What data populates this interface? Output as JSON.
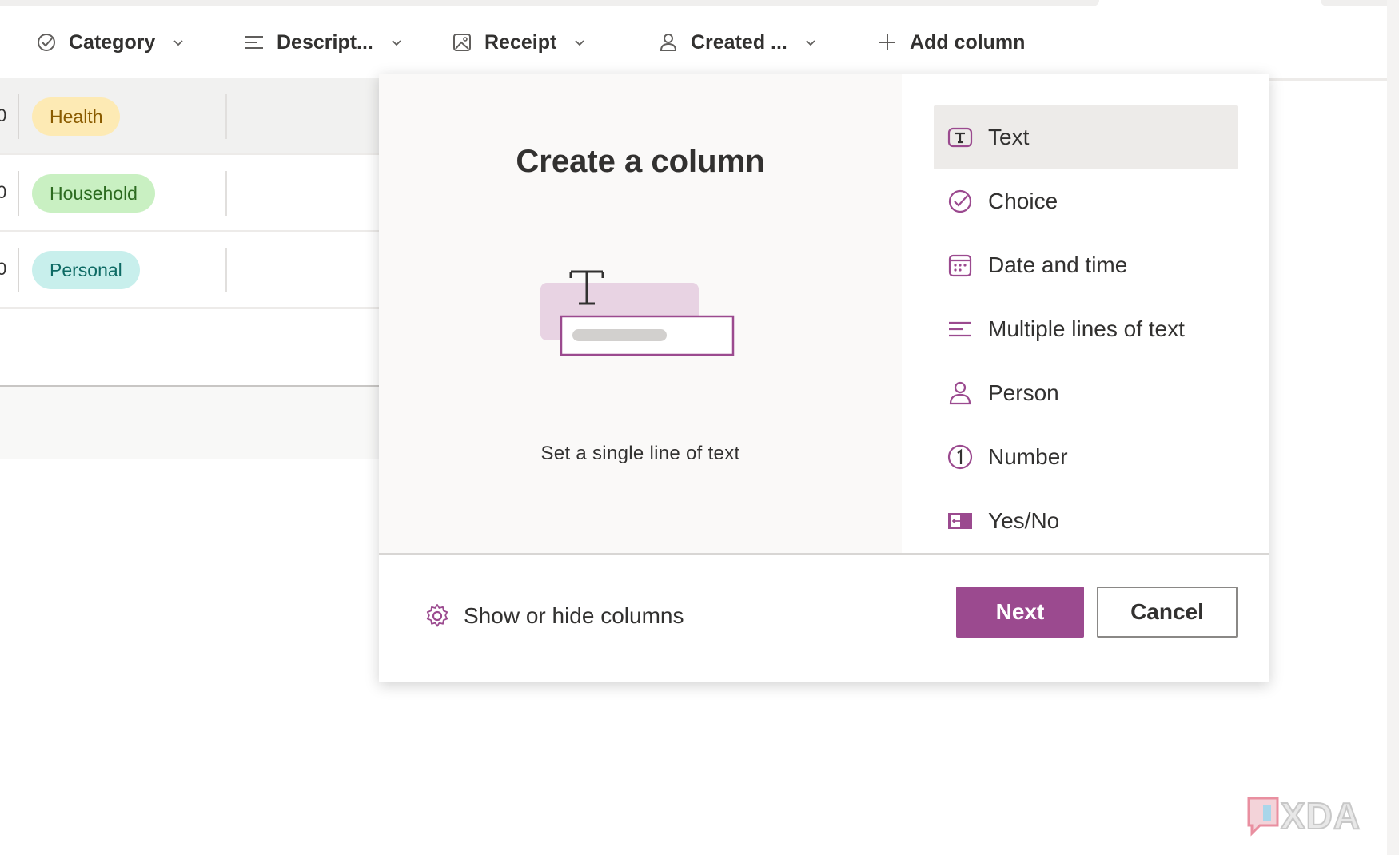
{
  "header": {
    "columns": [
      {
        "label": "Category",
        "icon": "choice-check-icon"
      },
      {
        "label": "Descript...",
        "icon": "lines-icon"
      },
      {
        "label": "Receipt",
        "icon": "image-icon"
      },
      {
        "label": "Created ...",
        "icon": "person-icon"
      }
    ],
    "add_column": "Add column"
  },
  "rows": [
    {
      "trunc": "0",
      "category": "Health",
      "pill_bg": "#fdeab4",
      "pill_fg": "#8a5b00"
    },
    {
      "trunc": "0",
      "category": "Household",
      "pill_bg": "#c9f0c2",
      "pill_fg": "#2c6b1f"
    },
    {
      "trunc": "0",
      "category": "Personal",
      "pill_bg": "#c8efec",
      "pill_fg": "#0e6a64"
    }
  ],
  "modal": {
    "title": "Create a column",
    "description": "Set a single line of text",
    "types": [
      {
        "label": "Text",
        "icon": "text-icon"
      },
      {
        "label": "Choice",
        "icon": "choice-icon"
      },
      {
        "label": "Date and time",
        "icon": "calendar-icon"
      },
      {
        "label": "Multiple lines of text",
        "icon": "multiline-icon"
      },
      {
        "label": "Person",
        "icon": "person-icon"
      },
      {
        "label": "Number",
        "icon": "number-icon"
      },
      {
        "label": "Yes/No",
        "icon": "yes-no-icon"
      }
    ],
    "show_hide": "Show or hide columns",
    "next": "Next",
    "cancel": "Cancel"
  },
  "watermark": "XDA",
  "colors": {
    "accent": "#9b4a8f",
    "icon": "#9b4a8f"
  }
}
